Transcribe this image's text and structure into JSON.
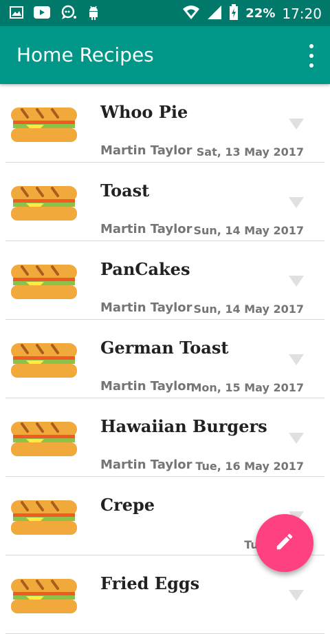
{
  "status_bar": {
    "battery": "22%",
    "time": "17:20",
    "icons": [
      "image-icon",
      "youtube-icon",
      "chat-icon",
      "android-icon",
      "wifi-icon",
      "signal-icon",
      "battery-icon"
    ]
  },
  "app_bar": {
    "title": "Home Recipes",
    "menu_icon": "overflow-menu-icon"
  },
  "recipes": [
    {
      "title": "Whoo Pie",
      "author": "Martin Taylor",
      "date": "Sat, 13 May 2017"
    },
    {
      "title": "Toast",
      "author": "Martin Taylor",
      "date": "Sun, 14 May 2017"
    },
    {
      "title": "PanCakes",
      "author": "Martin Taylor",
      "date": "Sun, 14 May 2017"
    },
    {
      "title": "German Toast",
      "author": "Martin Taylor",
      "date": "Mon, 15 May 2017"
    },
    {
      "title": "Hawaiian Burgers",
      "author": "Martin Taylor",
      "date": "Tue, 16 May 2017"
    },
    {
      "title": "Crepe",
      "author": "",
      "date": "Tue, 16 M"
    },
    {
      "title": "Fried Eggs",
      "author": "",
      "date": ""
    }
  ],
  "fab": {
    "icon": "edit-pencil-icon"
  },
  "colors": {
    "status_bar": "#00796B",
    "app_bar": "#009688",
    "fab": "#FF4081"
  }
}
